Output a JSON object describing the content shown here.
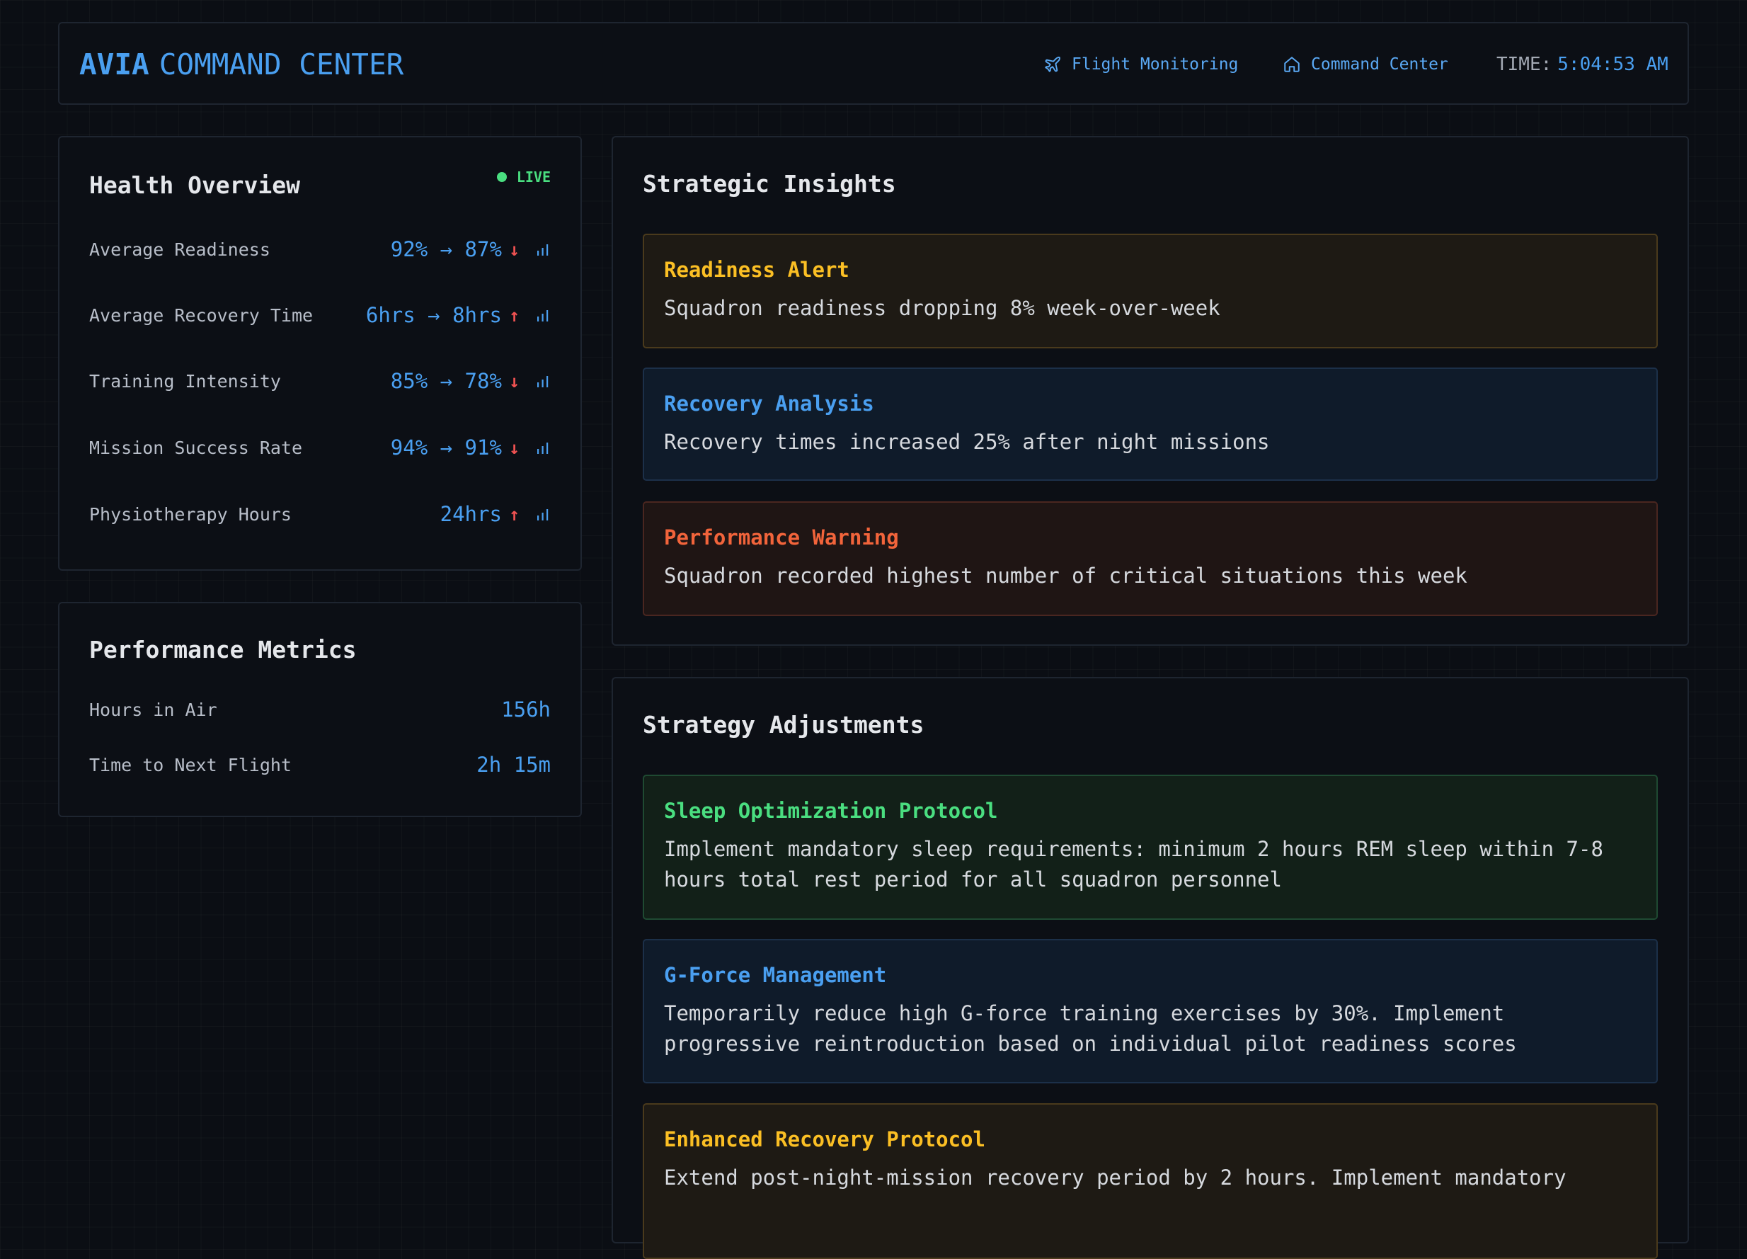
{
  "header": {
    "brand_bold": "AVIA",
    "brand_light": "COMMAND CENTER",
    "nav": [
      {
        "label": "Flight Monitoring",
        "icon": "plane-icon"
      },
      {
        "label": "Command Center",
        "icon": "home-icon"
      }
    ],
    "time_label": "TIME:",
    "time_value": "5:04:53 AM"
  },
  "health": {
    "title": "Health Overview",
    "live_label": "LIVE",
    "rows": [
      {
        "label": "Average Readiness",
        "value": "92% → 87%",
        "trend": "↓"
      },
      {
        "label": "Average Recovery Time",
        "value": "6hrs → 8hrs",
        "trend": "↑"
      },
      {
        "label": "Training Intensity",
        "value": "85% → 78%",
        "trend": "↓"
      },
      {
        "label": "Mission Success Rate",
        "value": "94% → 91%",
        "trend": "↓"
      },
      {
        "label": "Physiotherapy Hours",
        "value": "24hrs",
        "trend": "↑"
      }
    ]
  },
  "performance": {
    "title": "Performance Metrics",
    "rows": [
      {
        "label": "Hours in Air",
        "value": "156h"
      },
      {
        "label": "Time to Next Flight",
        "value": "2h 15m"
      }
    ]
  },
  "insights": {
    "title": "Strategic Insights",
    "cards": [
      {
        "title": "Readiness Alert",
        "text": "Squadron readiness dropping 8% week-over-week",
        "color": "#fbbf24"
      },
      {
        "title": "Recovery Analysis",
        "text": "Recovery times increased 25% after night missions",
        "color": "#4a9ff0"
      },
      {
        "title": "Performance Warning",
        "text": "Squadron recorded highest number of critical situations this week",
        "color": "#f2643b"
      }
    ]
  },
  "strategy": {
    "title": "Strategy Adjustments",
    "cards": [
      {
        "title": "Sleep Optimization Protocol",
        "text": "Implement mandatory sleep requirements: minimum 2 hours REM sleep within 7-8 hours total rest period for all squadron personnel",
        "color": "#4ade80"
      },
      {
        "title": "G-Force Management",
        "text": "Temporarily reduce high G-force training exercises by 30%. Implement progressive reintroduction based on individual pilot readiness scores",
        "color": "#4a9ff0"
      },
      {
        "title": "Enhanced Recovery Protocol",
        "text": "Extend post-night-mission recovery period by 2 hours. Implement mandatory",
        "color": "#fbbf24"
      }
    ]
  }
}
